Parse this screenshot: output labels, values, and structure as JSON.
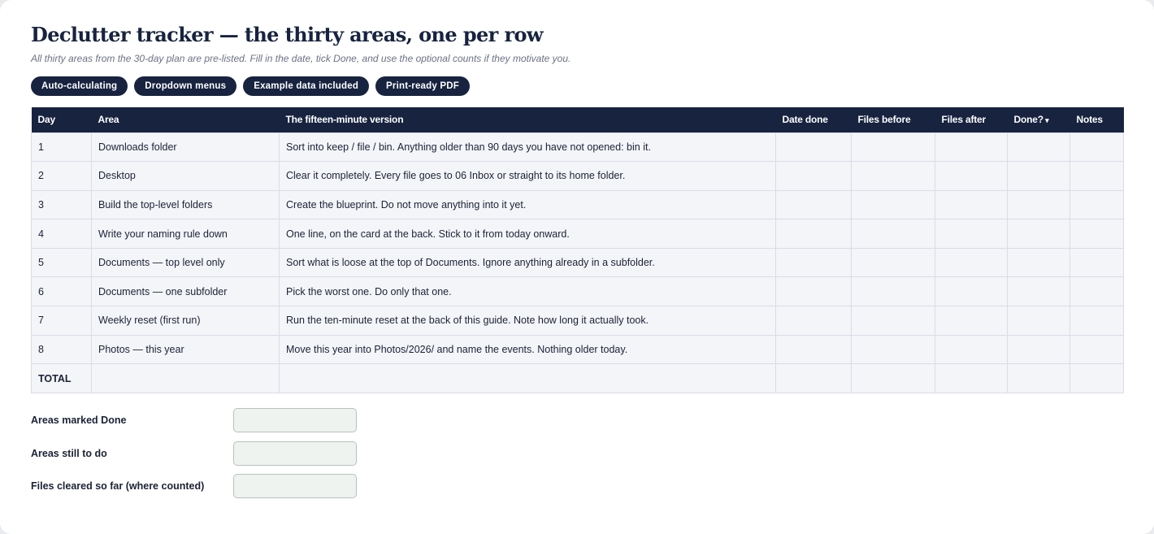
{
  "header": {
    "title": "Declutter tracker — the thirty areas, one per row",
    "subtitle": "All thirty areas from the 30-day plan are pre-listed. Fill in the date, tick Done, and use the optional counts if they motivate you."
  },
  "pills": [
    "Auto-calculating",
    "Dropdown menus",
    "Example data included",
    "Print-ready PDF"
  ],
  "table": {
    "columns": {
      "day": "Day",
      "area": "Area",
      "version": "The fifteen-minute version",
      "date_done": "Date done",
      "files_before": "Files before",
      "files_after": "Files after",
      "done": "Done?",
      "notes": "Notes"
    },
    "rows": [
      {
        "day": "1",
        "area": "Downloads folder",
        "version": "Sort into keep / file / bin. Anything older than 90 days you have not opened: bin it."
      },
      {
        "day": "2",
        "area": "Desktop",
        "version": "Clear it completely. Every file goes to 06 Inbox or straight to its home folder."
      },
      {
        "day": "3",
        "area": "Build the top-level folders",
        "version": "Create the blueprint. Do not move anything into it yet."
      },
      {
        "day": "4",
        "area": "Write your naming rule down",
        "version": "One line, on the card at the back. Stick to it from today onward."
      },
      {
        "day": "5",
        "area": "Documents — top level only",
        "version": "Sort what is loose at the top of Documents. Ignore anything already in a subfolder."
      },
      {
        "day": "6",
        "area": "Documents — one subfolder",
        "version": "Pick the worst one. Do only that one."
      },
      {
        "day": "7",
        "area": "Weekly reset (first run)",
        "version": "Run the ten-minute reset at the back of this guide. Note how long it actually took."
      },
      {
        "day": "8",
        "area": "Photos — this year",
        "version": "Move this year into Photos/2026/ and name the events. Nothing older today."
      }
    ],
    "total_label": "TOTAL"
  },
  "summary": {
    "marked_done": "Areas marked Done",
    "still_to_do": "Areas still to do",
    "files_cleared": "Files cleared so far (where counted)"
  }
}
